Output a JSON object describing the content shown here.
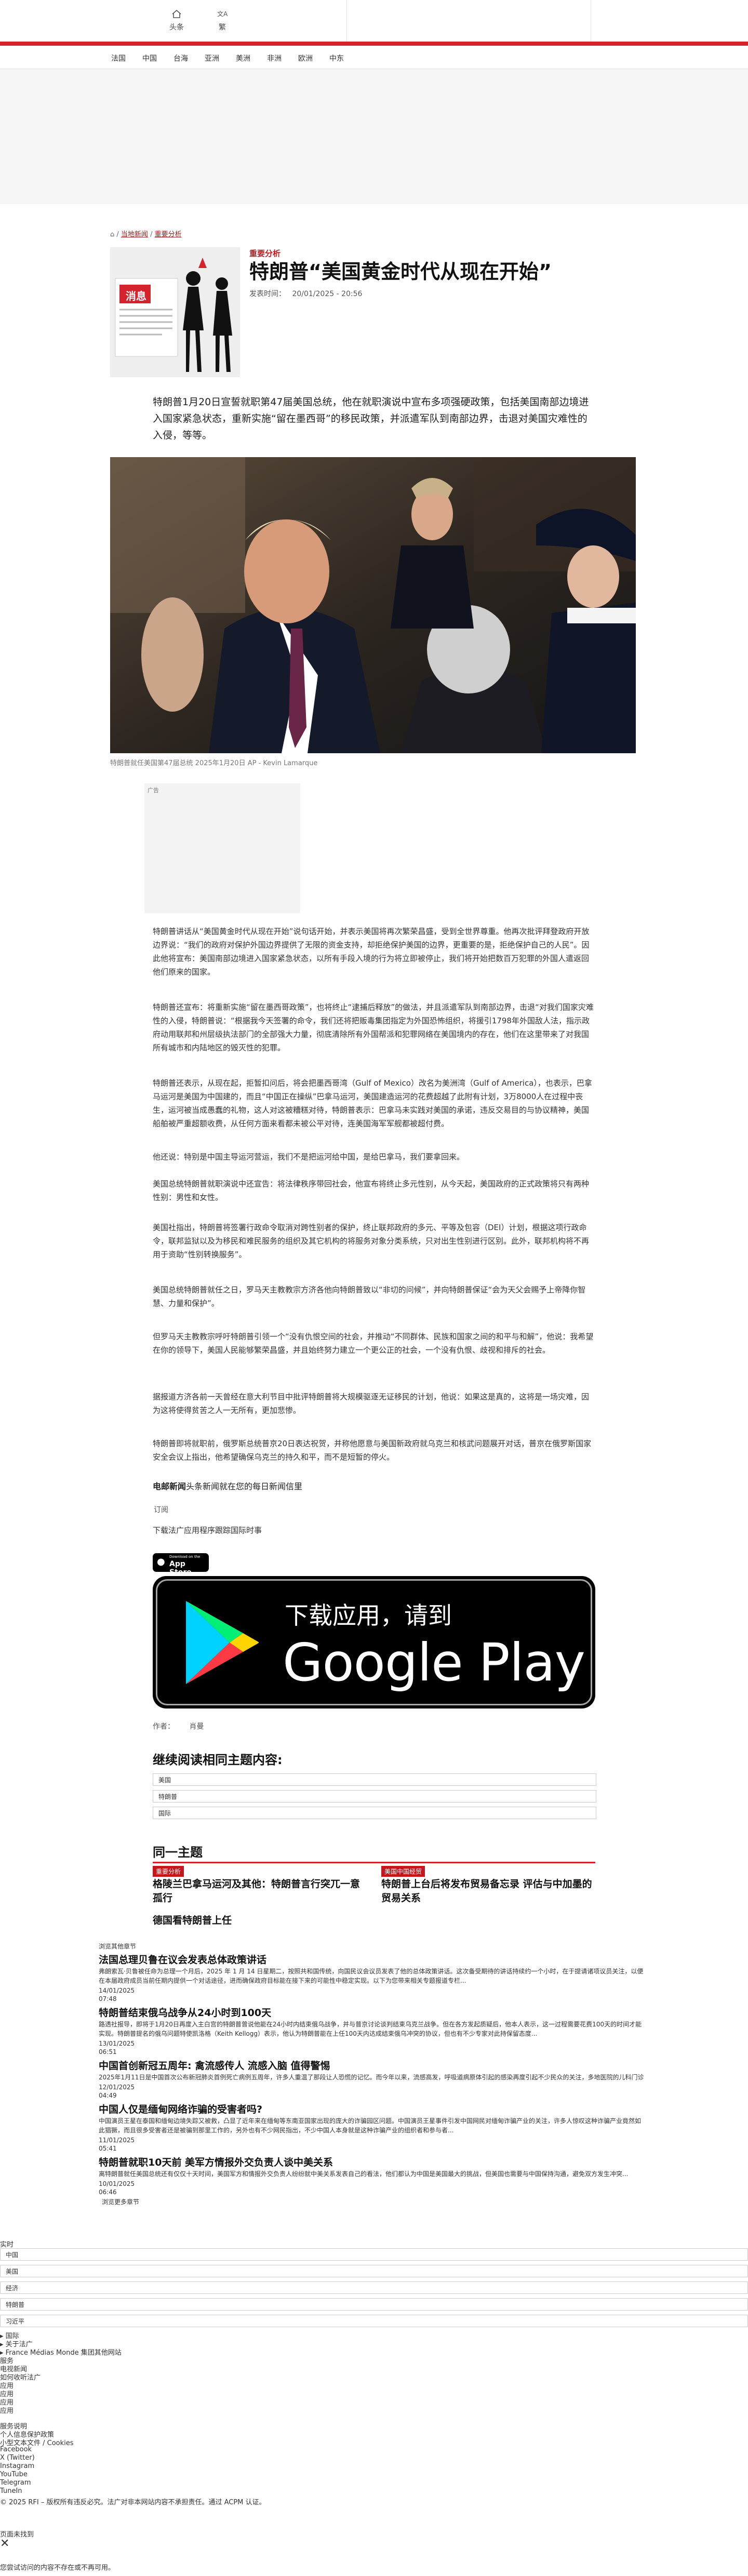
{
  "header": {
    "home_label": "头条",
    "lang_label": "繁"
  },
  "nav": {
    "items": [
      "法国",
      "中国",
      "台海",
      "亚洲",
      "美洲",
      "非洲",
      "欧洲",
      "中东"
    ]
  },
  "breadcrumb": {
    "items": [
      "当地新闻",
      "重要分析"
    ]
  },
  "article": {
    "tag": "重要分析",
    "title": "特朗普“美国黄金时代从现在开始”",
    "date_label": "发表时间：",
    "date_value": "20/01/2025 - 20:56",
    "thumb_word": "消息",
    "lede": "特朗普1月20日宣誓就职第47届美国总统，他在就职演说中宣布多项强硬政策，包括美国南部边境进入国家紧急状态，重新实施“留在墨西哥”的移民政策，并派遣军队到南部边界，击退对美国灾难性的入侵，等等。",
    "photo_caption": "特朗普就任美国第47届总统 2025年1月20日  AP - Kevin Lamarque",
    "ad_label": "广告",
    "paragraphs": [
      "特朗普讲话从“美国黄金时代从现在开始”说句话开始，并表示美国将再次繁荣昌盛，受到全世界尊重。他再次批评拜登政府开放边界说：“我们的政府对保护外国边界提供了无限的资金支持，却拒绝保护美国的边界，更重要的是，拒绝保护自己的人民”。因此他将宣布：美国南部边境进入国家紧急状态，以所有手段入境的行为将立即被停止，我们将开始把数百万犯罪的外国人遣返回他们原来的国家。",
      "特朗普还宣布：将重新实施“留在墨西哥政策”，也将终止“逮捕后释放”的做法，并且派遣军队到南部边界，击退“对我们国家灾难性的入侵，特朗普说：“根据我今天签署的命令，我们还将把贩毒集团指定为外国恐怖组织，将援引1798年外国敌人法，指示政府动用联邦和州层级执法部门的全部强大力量，彻底清除所有外国帮派和犯罪网络在美国境内的存在，他们在这里带来了对我国所有城市和内陆地区的毁灭性的犯罪。",
      "特朗普还表示，从现在起，拒暂扣问后，将会把墨西哥湾（Gulf of Mexico）改名为美洲湾（Gulf of America），也表示，巴拿马运河是美国为中国建的，而且“中国正在操纵”巴拿马运河，美国建造运河的花费超越了此附有计划，3万8000人在过程中丧生，运河被当成愚蠢的礼物，这人对这被糟糕对待，特朗普表示：巴拿马未实践对美国的承诺，违反交易目的与协议精神，美国船舶被严重超额收费，从任何方面来看都未被公平对待，连美国海军军舰都被超付费。",
      "他还说：特别是中国主导运河营运，我们不是把运河给中国，是给巴拿马，我们要拿回来。",
      "美国总统特朗普就职演说中还宣告：将法律秩序带回社会，他宣布将终止多元性别，从今天起，美国政府的正式政策将只有两种性别：男性和女性。",
      "美国社指出，特朗普将签署行政命令取消对跨性别者的保护，终止联邦政府的多元、平等及包容（DEI）计划，根据这项行政命令，联邦监狱以及为移民和难民服务的组织及其它机构的将服务对象分类系统，只对出生性别进行区别。此外，联邦机构将不再用于资助“性别转换服务”。",
      "美国总统特朗普就任之日，罗马天主教教宗方济各他向特朗普致以“非切的问候”，并向特朗普保证“会为天父会赐予上帝降你智慧、力量和保护”。",
      "但罗马天主教教宗呼吁特朗普引领一个“没有仇恨空间的社会，并推动“不同群体、民族和国家之间的和平与和解”，他说：我希望在你的领导下，美国人民能够繁荣昌盛，并且始终努力建立一个更公正的社会，一个没有仇恨、歧视和排斥的社会。",
      "据报道方济各前一天曾经在意大利节目中批评特朗普将大规模驱逐无证移民的计划，他说：如果这是真的，这将是一场灾难，因为这将使得贫苦之人一无所有，更加悲惨。",
      "特朗普即将就职前，俄罗斯总统普京20日表达祝贺，并称他愿意与美国新政府就乌克兰和核武问题展开对话，普京在俄罗斯国家安全会议上指出，他希望确保乌克兰的持久和平，而不是短暂的停火。"
    ],
    "promo_bold": "电邮新闻",
    "promo_text": "头条新闻就在您的每日新闻信里",
    "subscribe_label": "订阅",
    "download_text": "下载法广应用程序跟踪国际时事",
    "appstore_small": "Download on the",
    "appstore_big": "App Store",
    "gplay_line1": "下载应用，请到",
    "gplay_line2": "Google Play",
    "author_label": "作者：",
    "author_value": "肖曼"
  },
  "more_reading": {
    "heading": "继续阅读相同主题内容:",
    "tags": [
      "美国",
      "特朗普",
      "国际"
    ]
  },
  "same_topic": {
    "heading": "同一主题",
    "cards": [
      {
        "tag": "重要分析",
        "title": "格陵兰巴拿马运河及其他：特朗普言行突兀一意孤行"
      },
      {
        "tag": "美国中国经贸",
        "title": "特朗普上台后将发布贸易备忘录 评估与中加墨的贸易关系"
      },
      {
        "tag": "",
        "title": "德国看特朗普上任"
      }
    ]
  },
  "feed": {
    "header": "浏览其他章节",
    "items": [
      {
        "title": "法国总理贝鲁在议会发表总体政策讲话",
        "body": "弗朗索瓦·贝鲁被任命为总理一个月后，2025 年 1 月 14 日星期二，按照共和国传统，向国民议会议员发表了他的总体政策讲话。这次备受期待的讲话持续约一个小时，在于提请诸项议员关注，以便在本届政府成员当前任期内提供一个对话途径，进而确保政府目标能在接下来的可能性中稳定实现。以下为您带来相关专题报道专栏...",
        "date": "14/01/2025",
        "time": "07:48"
      },
      {
        "title": "特朗普结束俄乌战争从24小时到100天",
        "body": "路透社报导，即将于1月20日再度入主白宫的特朗普曾说他能在24小时内结束俄乌战争，并与普京讨论谈判结束乌克兰战争。但在各方发起质疑后，他本人表示，这一过程需要花费100天的时间才能实现。特朗普提名的俄乌问题特使凯洛格（Keith Kellogg）表示，他认为特朗普能在上任100天内达成结束俄乌冲突的协议，但也有不少专家对此持保留态度...",
        "date": "13/01/2025",
        "time": "06:51"
      },
      {
        "title": "中国首创新冠五周年: 禽流感传人 流感入脑 值得警惕",
        "body": "2025年1月11日是中国首次公布新冠肺炎首例死亡病例五周年，许多人重温了那段让人恐慌的记忆。而今年以来，流感高发，呼吸道病原体引起的感染再度引起不少民众的关注，多地医院的儿科门诊也大排长龙...",
        "date": "12/01/2025",
        "time": "04:49"
      },
      {
        "title": "中国人仅是缅甸网络诈骗的受害者吗?",
        "body": "中国演员王星在泰国和缅甸边境失踪又被救，凸显了近年来在缅甸等东南亚国家出现的庞大的诈骗园区问题。中国演员王星事件引发中国网民对缅甸诈骗产业的关注，许多人惊叹这种诈骗产业竟然如此猖獗，而且很多受害者还是被骗到那里工作的，另外也有不少网民指出，不少中国人本身就是这种诈骗产业的组织者和参与者...",
        "date": "11/01/2025",
        "time": "05:41"
      },
      {
        "title": "特朗普就职10天前 美军方情报外交负责人谈中美关系",
        "body": "离特朗普就任美国总统还有仅仅十天时间，美国军方和情报外交负责人纷纷就中美关系发表自己的看法，他们都认为中国是美国最大的挑战，但美国也需要与中国保持沟通，避免双方发生冲突...",
        "date": "10/01/2025",
        "time": "06:46"
      }
    ],
    "footer_link": "浏览更多章节"
  },
  "footer": {
    "live_label": "实时",
    "fields": [
      "中国",
      "美国",
      "经济",
      "特朗普",
      "习近平"
    ],
    "group_label": "▸ 国际",
    "about_label": "▸ 关于法广",
    "group_links": [
      "▸ France Médias Monde 集团其他网站",
      "服务",
      "电视新闻",
      "如何收听法广",
      "应用",
      "应用",
      "应用",
      "应用"
    ],
    "links": [
      "服务说明",
      "个人信息保护政策",
      "小型文本文件 / Cookies",
      "Facebook",
      "X (Twitter)",
      "Instagram",
      "YouTube",
      "Telegram",
      "TuneIn"
    ],
    "copyright": "© 2025 RFI – 版权所有违反必究。法广对非本网站内容不承担责任。通过 ACPM 认证。",
    "banner_title": "页面未找到",
    "close_glyph": "✕",
    "banner_text": "您尝试访问的内容不存在或不再可用。"
  }
}
